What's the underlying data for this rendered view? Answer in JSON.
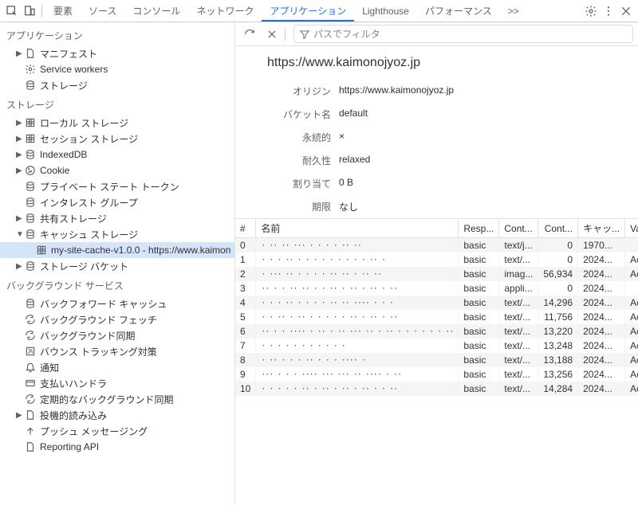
{
  "tabs": {
    "items": [
      "要素",
      "ソース",
      "コンソール",
      "ネットワーク",
      "アプリケーション",
      "Lighthouse",
      "パフォーマンス"
    ],
    "active_index": 4,
    "more": ">>"
  },
  "sidebar": {
    "section_app": "アプリケーション",
    "app_items": [
      {
        "icon": "file",
        "label": "マニフェスト",
        "arrow": true
      },
      {
        "icon": "gear",
        "label": "Service workers"
      },
      {
        "icon": "db",
        "label": "ストレージ"
      }
    ],
    "section_storage": "ストレージ",
    "storage_items": [
      {
        "icon": "grid",
        "label": "ローカル ストレージ",
        "arrow": true
      },
      {
        "icon": "grid",
        "label": "セッション ストレージ",
        "arrow": true
      },
      {
        "icon": "db",
        "label": "IndexedDB",
        "arrow": true
      },
      {
        "icon": "cookie",
        "label": "Cookie",
        "arrow": true
      },
      {
        "icon": "db",
        "label": "プライベート ステート トークン"
      },
      {
        "icon": "db",
        "label": "インタレスト グループ"
      },
      {
        "icon": "db",
        "label": "共有ストレージ",
        "arrow": true
      },
      {
        "icon": "db",
        "label": "キャッシュ ストレージ",
        "arrow": true,
        "expanded": true
      },
      {
        "icon": "grid",
        "label": "my-site-cache-v1.0.0 - https://www.kaimon",
        "indent": 2,
        "selected": true
      },
      {
        "icon": "db",
        "label": "ストレージ バケット",
        "arrow": true
      }
    ],
    "section_bg": "バックグラウンド サービス",
    "bg_items": [
      {
        "icon": "db",
        "label": "バックフォワード キャッシュ"
      },
      {
        "icon": "sync",
        "label": "バックグラウンド フェッチ"
      },
      {
        "icon": "sync",
        "label": "バックグラウンド同期"
      },
      {
        "icon": "bounce",
        "label": "バウンス トラッキング対策"
      },
      {
        "icon": "bell",
        "label": "通知"
      },
      {
        "icon": "card",
        "label": "支払いハンドラ"
      },
      {
        "icon": "sync",
        "label": "定期的なバックグラウンド同期"
      },
      {
        "icon": "file",
        "label": "投機的読み込み",
        "arrow": true
      },
      {
        "icon": "up",
        "label": "プッシュ メッセージング"
      },
      {
        "icon": "file",
        "label": "Reporting API"
      }
    ]
  },
  "toolbar": {
    "filter_placeholder": "パスでフィルタ"
  },
  "detail": {
    "title": "https://www.kaimonojyoz.jp",
    "rows": [
      {
        "label": "オリジン",
        "value": "https://www.kaimonojyoz.jp"
      },
      {
        "label": "バケット名",
        "value": "default"
      },
      {
        "label": "永続的",
        "value": "×"
      },
      {
        "label": "耐久性",
        "value": "relaxed"
      },
      {
        "label": "割り当て",
        "value": "0 B"
      },
      {
        "label": "期限",
        "value": "なし"
      }
    ]
  },
  "grid": {
    "headers": [
      "#",
      "名前",
      "Resp...",
      "Cont...",
      "Cont...",
      "キャッ...",
      "Vary ..."
    ],
    "rows": [
      {
        "i": 0,
        "resp": "basic",
        "ct": "text/j...",
        "cl": "0",
        "tc": "1970...",
        "vary": ""
      },
      {
        "i": 1,
        "resp": "basic",
        "ct": "text/...",
        "cl": "0",
        "tc": "2024...",
        "vary": "Acce..."
      },
      {
        "i": 2,
        "resp": "basic",
        "ct": "imag...",
        "cl": "56,934",
        "tc": "2024...",
        "vary": "Acce..."
      },
      {
        "i": 3,
        "resp": "basic",
        "ct": "appli...",
        "cl": "0",
        "tc": "2024...",
        "vary": ""
      },
      {
        "i": 4,
        "resp": "basic",
        "ct": "text/...",
        "cl": "14,296",
        "tc": "2024...",
        "vary": "Acce..."
      },
      {
        "i": 5,
        "resp": "basic",
        "ct": "text/...",
        "cl": "11,756",
        "tc": "2024...",
        "vary": "Acce..."
      },
      {
        "i": 6,
        "resp": "basic",
        "ct": "text/...",
        "cl": "13,220",
        "tc": "2024...",
        "vary": "Acce..."
      },
      {
        "i": 7,
        "resp": "basic",
        "ct": "text/...",
        "cl": "13,248",
        "tc": "2024...",
        "vary": "Acce..."
      },
      {
        "i": 8,
        "resp": "basic",
        "ct": "text/...",
        "cl": "13,188",
        "tc": "2024...",
        "vary": "Acce..."
      },
      {
        "i": 9,
        "resp": "basic",
        "ct": "text/...",
        "cl": "13,256",
        "tc": "2024...",
        "vary": "Acce..."
      },
      {
        "i": 10,
        "resp": "basic",
        "ct": "text/...",
        "cl": "14,284",
        "tc": "2024...",
        "vary": "Acce..."
      }
    ]
  }
}
